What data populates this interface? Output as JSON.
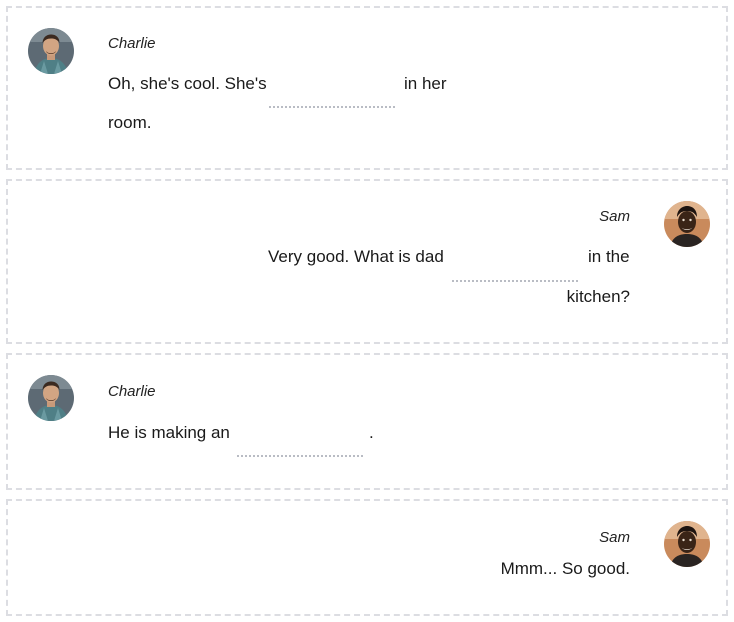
{
  "messages": [
    {
      "speaker": "Charlie",
      "line1_before": "Oh, she's cool. She's",
      "line1_after": "in her",
      "line2": "room.",
      "blank_value": ""
    },
    {
      "speaker": "Sam",
      "line1_before": "Very good. What is dad",
      "line1_after": "in the",
      "line2": "kitchen?",
      "blank_value": ""
    },
    {
      "speaker": "Charlie",
      "line1_before": "He is making an",
      "line1_after": ".",
      "blank_value": ""
    },
    {
      "speaker": "Sam",
      "text": "Mmm... So good."
    }
  ],
  "colors": {
    "card_border": "#dcdde2",
    "blank_underline": "#b9bcc4",
    "charlie_avatar_bg": "#5d6a74",
    "sam_avatar_bg": "#c98a5c"
  },
  "icons": {
    "charlie": "person-avatar-icon",
    "sam": "person-avatar-icon"
  }
}
